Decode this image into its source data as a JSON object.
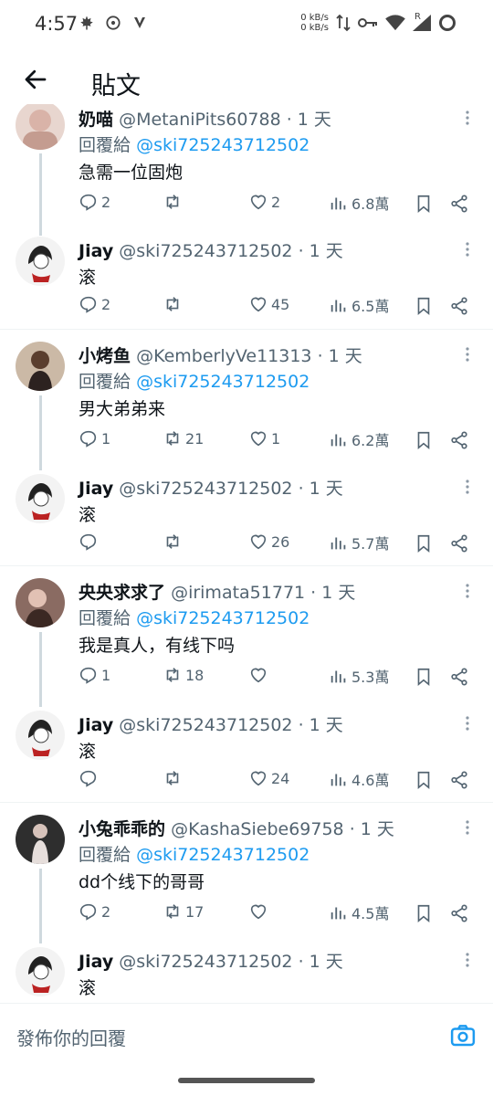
{
  "status_bar": {
    "time": "4:57",
    "net_speed_up": "0 kB/s",
    "net_speed_down": "0 kB/s",
    "signal_badge": "R"
  },
  "header": {
    "title": "貼文"
  },
  "posts": [
    {
      "display_name": "奶喵",
      "handle": "@MetaniPits60788",
      "time": "· 1 天",
      "reply_prefix": "回覆給",
      "reply_to": "@ski725243712502",
      "text": "急需一位固炮",
      "replies": "2",
      "retweets": "",
      "likes": "2",
      "views": "6.8萬",
      "avatar_color": "#d9b3a8"
    },
    {
      "display_name": "Jiay",
      "handle": "@ski725243712502",
      "time": "· 1 天",
      "text": "滚",
      "replies": "2",
      "retweets": "",
      "likes": "45",
      "views": "6.5萬",
      "avatar_color": "#f1f1f1"
    },
    {
      "display_name": "小烤鱼",
      "handle": "@KemberlyVe11313",
      "time": "· 1 天",
      "reply_prefix": "回覆給",
      "reply_to": "@ski725243712502",
      "text": "男大弟弟来",
      "replies": "1",
      "retweets": "21",
      "likes": "1",
      "views": "6.2萬",
      "avatar_color": "#b79b83"
    },
    {
      "display_name": "Jiay",
      "handle": "@ski725243712502",
      "time": "· 1 天",
      "text": "滚",
      "replies": "",
      "retweets": "",
      "likes": "26",
      "views": "5.7萬",
      "avatar_color": "#f1f1f1"
    },
    {
      "display_name": "央央求求了",
      "handle": "@irimata51771",
      "time": "· 1 天",
      "reply_prefix": "回覆給",
      "reply_to": "@ski725243712502",
      "text": "我是真人，有线下吗",
      "replies": "1",
      "retweets": "18",
      "likes": "",
      "views": "5.3萬",
      "avatar_color": "#6b4d46"
    },
    {
      "display_name": "Jiay",
      "handle": "@ski725243712502",
      "time": "· 1 天",
      "text": "滚",
      "replies": "",
      "retweets": "",
      "likes": "24",
      "views": "4.6萬",
      "avatar_color": "#f1f1f1"
    },
    {
      "display_name": "小兔乖乖的",
      "handle": "@KashaSiebe69758",
      "time": "· 1 天",
      "reply_prefix": "回覆給",
      "reply_to": "@ski725243712502",
      "text": "dd个线下的哥哥",
      "replies": "2",
      "retweets": "17",
      "likes": "",
      "views": "4.5萬",
      "avatar_color": "#3a3a3a"
    },
    {
      "display_name": "Jiay",
      "handle": "@ski725243712502",
      "time": "· 1 天",
      "text": "滚",
      "avatar_color": "#f1f1f1"
    }
  ],
  "composer": {
    "placeholder": "發佈你的回覆"
  },
  "colors": {
    "accent": "#1d9bf0",
    "text": "#0f1419",
    "muted": "#536471",
    "divider": "#eff3f4"
  },
  "icons": {
    "back": "arrow-left-icon",
    "reply": "reply-icon",
    "retweet": "retweet-icon",
    "like": "heart-icon",
    "views": "views-icon",
    "bookmark": "bookmark-icon",
    "share": "share-icon",
    "more": "more-vertical-icon",
    "camera": "camera-icon"
  }
}
